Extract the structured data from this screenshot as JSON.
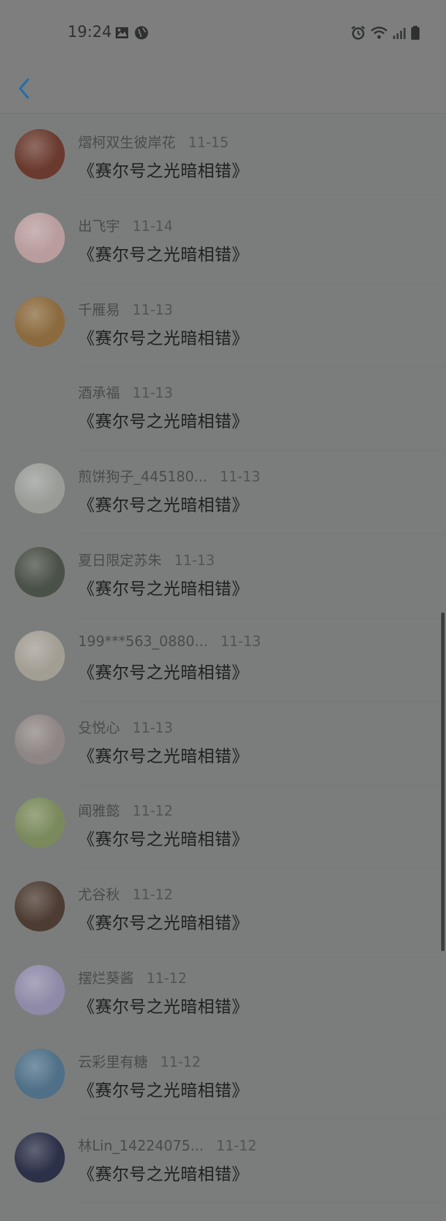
{
  "status_bar": {
    "time": "19:24",
    "icons": [
      "image-icon",
      "globe-icon",
      "alarm-icon",
      "wifi-icon",
      "signal-icon",
      "battery-icon"
    ]
  },
  "header": {
    "back_icon": "chevron-left-icon",
    "accent": "#1f6ea8"
  },
  "comments": [
    {
      "user": "熠柯双生彼岸花",
      "date": "11-15",
      "message": "《赛尔号之光暗相错》",
      "avatar_color": "#6a3a2e"
    },
    {
      "user": "出飞宇",
      "date": "11-14",
      "message": "《赛尔号之光暗相错》",
      "avatar_color": "#b99c9d"
    },
    {
      "user": "千雁易",
      "date": "11-13",
      "message": "《赛尔号之光暗相错》",
      "avatar_color": "#8b6a3e"
    },
    {
      "user": "酒承福",
      "date": "11-13",
      "message": "《赛尔号之光暗相错》",
      "avatar_color": ""
    },
    {
      "user": "煎饼狗子_445180...",
      "date": "11-13",
      "message": "《赛尔号之光暗相错》",
      "avatar_color": "#9a9c98"
    },
    {
      "user": "夏日限定苏朱",
      "date": "11-13",
      "message": "《赛尔号之光暗相错》",
      "avatar_color": "#4a5148"
    },
    {
      "user": "199***563_0880...",
      "date": "11-13",
      "message": "《赛尔号之光暗相错》",
      "avatar_color": "#a39e94"
    },
    {
      "user": "殳悦心",
      "date": "11-13",
      "message": "《赛尔号之光暗相错》",
      "avatar_color": "#8e8684"
    },
    {
      "user": "闻雅懿",
      "date": "11-12",
      "message": "《赛尔号之光暗相错》",
      "avatar_color": "#7a8a5c"
    },
    {
      "user": "尤谷秋",
      "date": "11-12",
      "message": "《赛尔号之光暗相错》",
      "avatar_color": "#4d3c33"
    },
    {
      "user": "摆烂葵酱",
      "date": "11-12",
      "message": "《赛尔号之光暗相错》",
      "avatar_color": "#8f8aa8"
    },
    {
      "user": "云彩里有糖",
      "date": "11-12",
      "message": "《赛尔号之光暗相错》",
      "avatar_color": "#4f7088"
    },
    {
      "user": "林Lin_14224075...",
      "date": "11-12",
      "message": "《赛尔号之光暗相错》",
      "avatar_color": "#2c3048"
    }
  ]
}
